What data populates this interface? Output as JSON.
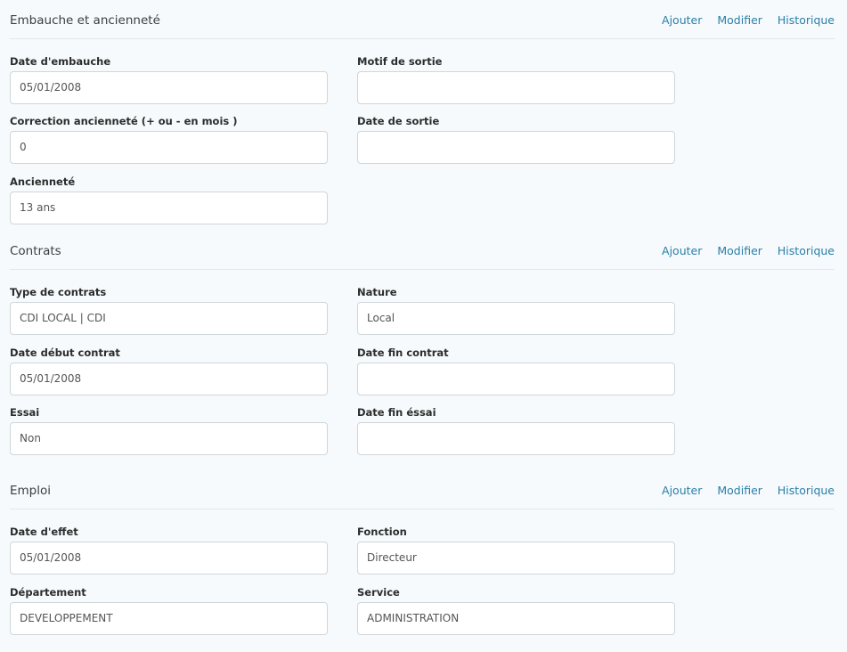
{
  "sections": [
    {
      "title": "Embauche et ancienneté",
      "actions": [
        "Ajouter",
        "Modifier",
        "Historique"
      ],
      "fields": [
        {
          "label": "Date d'embauche",
          "value": "05/01/2008"
        },
        {
          "label": "Motif de sortie",
          "value": ""
        },
        {
          "label": "Correction ancienneté (+ ou - en mois )",
          "value": "0"
        },
        {
          "label": "Date de sortie",
          "value": ""
        },
        {
          "label": "Ancienneté",
          "value": "13 ans"
        }
      ]
    },
    {
      "title": "Contrats",
      "actions": [
        "Ajouter",
        "Modifier",
        "Historique"
      ],
      "fields": [
        {
          "label": "Type de contrats",
          "value": "CDI LOCAL | CDI"
        },
        {
          "label": "Nature",
          "value": "Local"
        },
        {
          "label": "Date début contrat",
          "value": "05/01/2008"
        },
        {
          "label": "Date fin contrat",
          "value": ""
        },
        {
          "label": "Essai",
          "value": "Non"
        },
        {
          "label": "Date fin éssai",
          "value": ""
        }
      ]
    },
    {
      "title": "Emploi",
      "actions": [
        "Ajouter",
        "Modifier",
        "Historique"
      ],
      "fields": [
        {
          "label": "Date d'effet",
          "value": "05/01/2008"
        },
        {
          "label": "Fonction",
          "value": "Directeur"
        },
        {
          "label": "Département",
          "value": "DEVELOPPEMENT"
        },
        {
          "label": "Service",
          "value": "ADMINISTRATION"
        }
      ]
    }
  ]
}
